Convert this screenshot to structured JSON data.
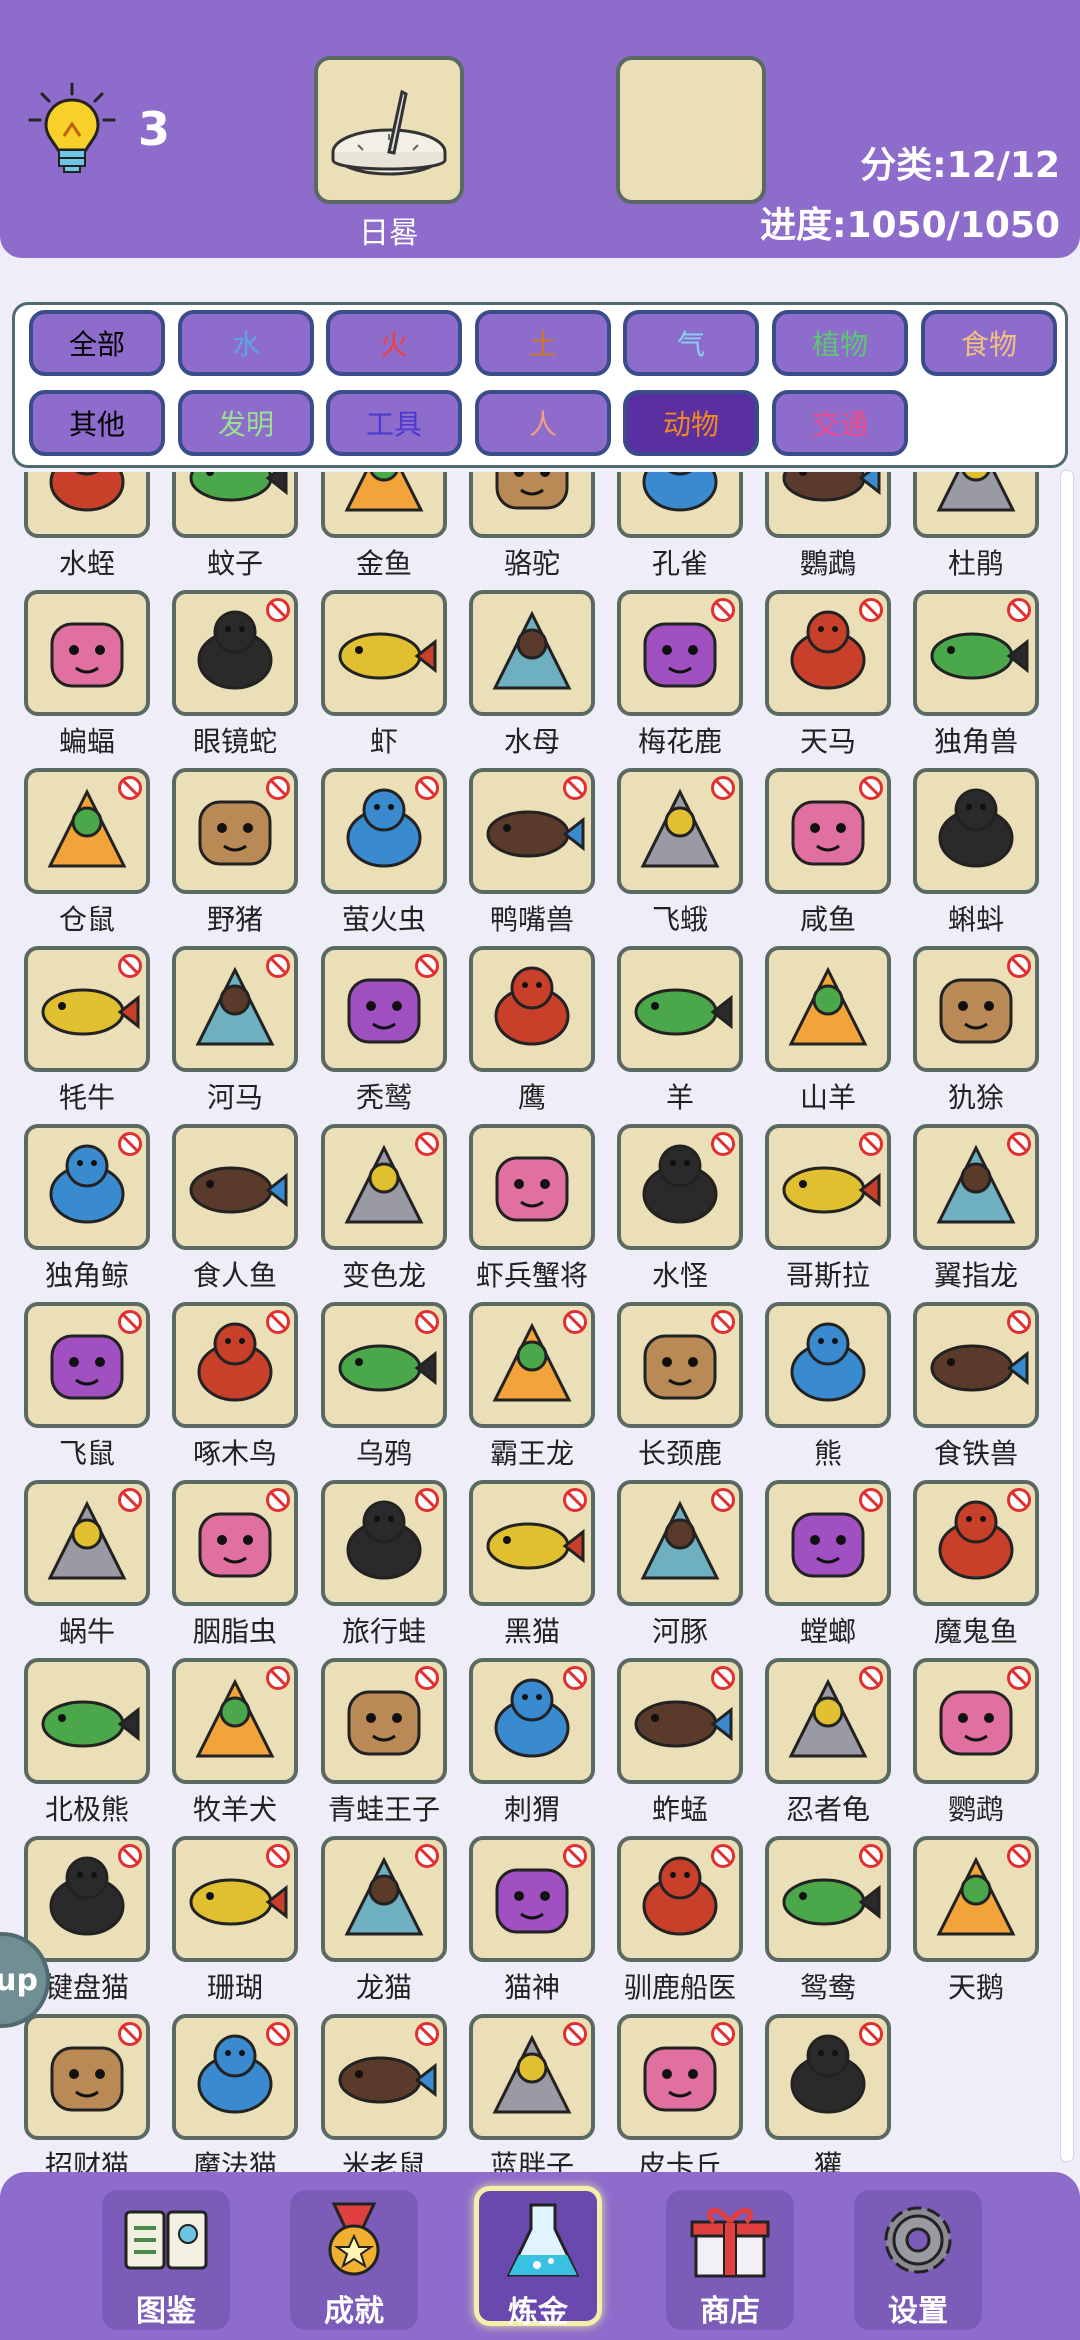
{
  "header": {
    "hint_count": "3",
    "slot1_label": "日晷",
    "category_stat": "分类:12/12",
    "progress_stat": "进度:1050/1050"
  },
  "filters": [
    {
      "label": "全部",
      "color": "#000000",
      "active": false
    },
    {
      "label": "水",
      "color": "#5aa7e0",
      "active": false
    },
    {
      "label": "火",
      "color": "#f04040",
      "active": false
    },
    {
      "label": "土",
      "color": "#c87a2a",
      "active": false
    },
    {
      "label": "气",
      "color": "#8ad0f0",
      "active": false
    },
    {
      "label": "植物",
      "color": "#5cc870",
      "active": false
    },
    {
      "label": "食物",
      "color": "#f2c080",
      "active": false
    },
    {
      "label": "其他",
      "color": "#000000",
      "active": false
    },
    {
      "label": "发明",
      "color": "#9ae090",
      "active": false
    },
    {
      "label": "工具",
      "color": "#4a3ad0",
      "active": false
    },
    {
      "label": "人",
      "color": "#f0a080",
      "active": false
    },
    {
      "label": "动物",
      "color": "#f08a20",
      "active": true
    },
    {
      "label": "交通",
      "color": "#f04a8a",
      "active": false
    }
  ],
  "grid": {
    "rows": [
      [
        {
          "name": "水蛭",
          "icon": "leech-icon",
          "locked": false
        },
        {
          "name": "蚊子",
          "icon": "mosquito-icon",
          "locked": false
        },
        {
          "name": "金鱼",
          "icon": "goldfish-icon",
          "locked": false
        },
        {
          "name": "骆驼",
          "icon": "camel-icon",
          "locked": false
        },
        {
          "name": "孔雀",
          "icon": "peacock-icon",
          "locked": false
        },
        {
          "name": "鸚鵡",
          "icon": "mynah-icon",
          "locked": false
        },
        {
          "name": "杜鹃",
          "icon": "cuckoo-icon",
          "locked": false
        }
      ],
      [
        {
          "name": "蝙蝠",
          "icon": "bat-icon",
          "locked": false
        },
        {
          "name": "眼镜蛇",
          "icon": "cobra-icon",
          "locked": true
        },
        {
          "name": "虾",
          "icon": "shrimp-icon",
          "locked": false
        },
        {
          "name": "水母",
          "icon": "jellyfish-icon",
          "locked": false
        },
        {
          "name": "梅花鹿",
          "icon": "deer-icon",
          "locked": true
        },
        {
          "name": "天马",
          "icon": "pegasus-icon",
          "locked": true
        },
        {
          "name": "独角兽",
          "icon": "unicorn-icon",
          "locked": true
        }
      ],
      [
        {
          "name": "仓鼠",
          "icon": "hamster-icon",
          "locked": true
        },
        {
          "name": "野猪",
          "icon": "boar-icon",
          "locked": true
        },
        {
          "name": "萤火虫",
          "icon": "firefly-icon",
          "locked": true
        },
        {
          "name": "鸭嘴兽",
          "icon": "platypus-icon",
          "locked": true
        },
        {
          "name": "飞蛾",
          "icon": "moth-icon",
          "locked": true
        },
        {
          "name": "咸鱼",
          "icon": "salted-fish-icon",
          "locked": true
        },
        {
          "name": "蝌蚪",
          "icon": "tadpole-icon",
          "locked": false
        }
      ],
      [
        {
          "name": "牦牛",
          "icon": "yak-icon",
          "locked": true
        },
        {
          "name": "河马",
          "icon": "hippo-icon",
          "locked": true
        },
        {
          "name": "秃鹫",
          "icon": "vulture-icon",
          "locked": true
        },
        {
          "name": "鹰",
          "icon": "eagle-icon",
          "locked": false
        },
        {
          "name": "羊",
          "icon": "sheep-icon",
          "locked": false
        },
        {
          "name": "山羊",
          "icon": "goat-icon",
          "locked": false
        },
        {
          "name": "犰狳",
          "icon": "armadillo-icon",
          "locked": true
        }
      ],
      [
        {
          "name": "独角鲸",
          "icon": "narwhal-icon",
          "locked": true
        },
        {
          "name": "食人鱼",
          "icon": "piranha-icon",
          "locked": false
        },
        {
          "name": "变色龙",
          "icon": "chameleon-icon",
          "locked": true
        },
        {
          "name": "虾兵蟹将",
          "icon": "shrimp-crab-soldiers-icon",
          "locked": false
        },
        {
          "name": "水怪",
          "icon": "lake-monster-icon",
          "locked": true
        },
        {
          "name": "哥斯拉",
          "icon": "godzilla-icon",
          "locked": true
        },
        {
          "name": "翼指龙",
          "icon": "pterodactyl-icon",
          "locked": true
        }
      ],
      [
        {
          "name": "飞鼠",
          "icon": "flying-squirrel-icon",
          "locked": true
        },
        {
          "name": "啄木鸟",
          "icon": "woodpecker-icon",
          "locked": true
        },
        {
          "name": "乌鸦",
          "icon": "crow-icon",
          "locked": true
        },
        {
          "name": "霸王龙",
          "icon": "trex-icon",
          "locked": true
        },
        {
          "name": "长颈鹿",
          "icon": "giraffe-icon",
          "locked": true
        },
        {
          "name": "熊",
          "icon": "bear-icon",
          "locked": false
        },
        {
          "name": "食铁兽",
          "icon": "panda-icon",
          "locked": true
        }
      ],
      [
        {
          "name": "蜗牛",
          "icon": "snail-icon",
          "locked": true
        },
        {
          "name": "胭脂虫",
          "icon": "cochineal-icon",
          "locked": true
        },
        {
          "name": "旅行蛙",
          "icon": "travel-frog-icon",
          "locked": true
        },
        {
          "name": "黑猫",
          "icon": "black-cat-icon",
          "locked": true
        },
        {
          "name": "河豚",
          "icon": "pufferfish-icon",
          "locked": true
        },
        {
          "name": "螳螂",
          "icon": "mantis-icon",
          "locked": true
        },
        {
          "name": "魔鬼鱼",
          "icon": "manta-ray-icon",
          "locked": true
        }
      ],
      [
        {
          "name": "北极熊",
          "icon": "polar-bear-icon",
          "locked": false
        },
        {
          "name": "牧羊犬",
          "icon": "collie-icon",
          "locked": true
        },
        {
          "name": "青蛙王子",
          "icon": "frog-prince-icon",
          "locked": true
        },
        {
          "name": "刺猬",
          "icon": "hedgehog-icon",
          "locked": true
        },
        {
          "name": "蚱蜢",
          "icon": "grasshopper-icon",
          "locked": true
        },
        {
          "name": "忍者龟",
          "icon": "ninja-turtle-icon",
          "locked": true
        },
        {
          "name": "鹦鹉",
          "icon": "parrot-icon",
          "locked": true
        }
      ],
      [
        {
          "name": "键盘猫",
          "icon": "keyboard-cat-icon",
          "locked": true
        },
        {
          "name": "珊瑚",
          "icon": "coral-icon",
          "locked": true
        },
        {
          "name": "龙猫",
          "icon": "totoro-icon",
          "locked": true
        },
        {
          "name": "猫神",
          "icon": "cat-god-icon",
          "locked": true
        },
        {
          "name": "驯鹿船医",
          "icon": "reindeer-doctor-icon",
          "locked": true
        },
        {
          "name": "鸳鸯",
          "icon": "mandarin-duck-icon",
          "locked": true
        },
        {
          "name": "天鹅",
          "icon": "swan-icon",
          "locked": true
        }
      ],
      [
        {
          "name": "招财猫",
          "icon": "lucky-cat-icon",
          "locked": true
        },
        {
          "name": "魔法猫",
          "icon": "magic-cat-icon",
          "locked": true
        },
        {
          "name": "米老鼠",
          "icon": "mickey-icon",
          "locked": true
        },
        {
          "name": "蓝胖子",
          "icon": "blue-fatty-icon",
          "locked": true
        },
        {
          "name": "皮卡丘",
          "icon": "pikachu-icon",
          "locked": true
        },
        {
          "name": "獾",
          "icon": "badger-icon",
          "locked": true
        }
      ]
    ]
  },
  "side_button": {
    "label": "up"
  },
  "nav": [
    {
      "label": "图鉴",
      "icon": "book-icon",
      "active": false
    },
    {
      "label": "成就",
      "icon": "medal-icon",
      "active": false
    },
    {
      "label": "炼金",
      "icon": "flask-icon",
      "active": true
    },
    {
      "label": "商店",
      "icon": "gift-icon",
      "active": false
    },
    {
      "label": "设置",
      "icon": "gear-icon",
      "active": false
    }
  ],
  "colors": {
    "primary": "#8e6ccc",
    "tile": "#ebdfb8",
    "tile_border": "#5a6a63"
  }
}
